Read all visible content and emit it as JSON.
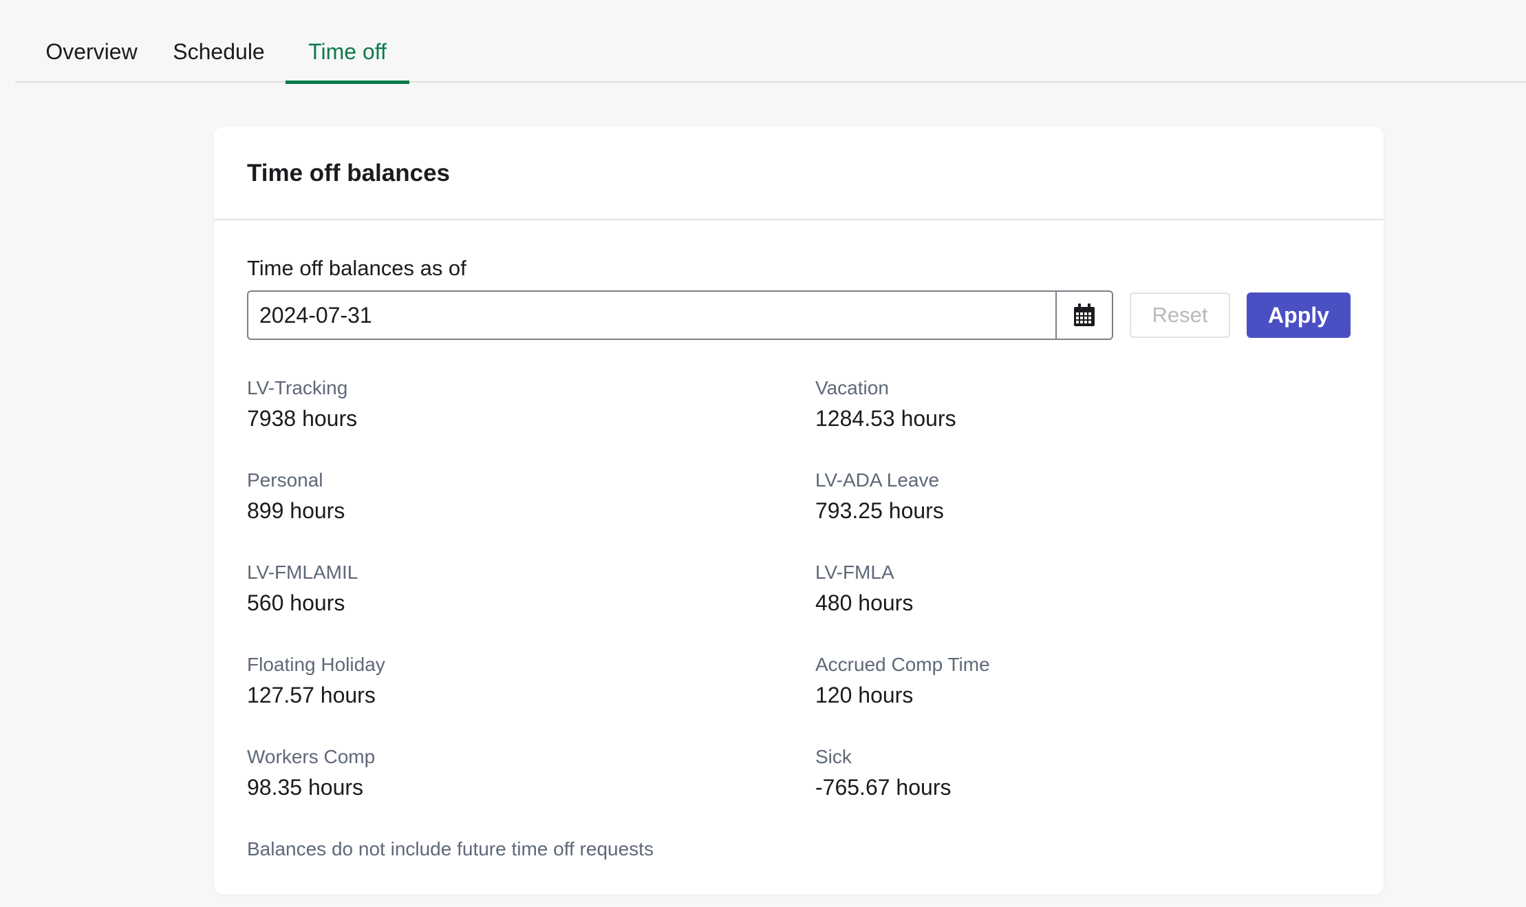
{
  "tabs": [
    {
      "label": "Overview",
      "active": false
    },
    {
      "label": "Schedule",
      "active": false
    },
    {
      "label": "Time off",
      "active": true
    }
  ],
  "card": {
    "title": "Time off balances",
    "as_of_label": "Time off balances as of",
    "date_value": "2024-07-31",
    "reset_label": "Reset",
    "apply_label": "Apply",
    "note": "Balances do not include future time off requests"
  },
  "balances": [
    {
      "name": "LV-Tracking",
      "value": "7938 hours"
    },
    {
      "name": "Vacation",
      "value": "1284.53 hours"
    },
    {
      "name": "Personal",
      "value": "899 hours"
    },
    {
      "name": "LV-ADA Leave",
      "value": "793.25 hours"
    },
    {
      "name": "LV-FMLAMIL",
      "value": "560 hours"
    },
    {
      "name": "LV-FMLA",
      "value": "480 hours"
    },
    {
      "name": "Floating Holiday",
      "value": "127.57 hours"
    },
    {
      "name": "Accrued Comp Time",
      "value": "120 hours"
    },
    {
      "name": "Workers Comp",
      "value": "98.35 hours"
    },
    {
      "name": "Sick",
      "value": "-765.67 hours"
    }
  ],
  "colors": {
    "active_tab": "#0a7a4a",
    "apply_button": "#4b4fc4",
    "muted_text": "#5e6878"
  },
  "icons": {
    "date_picker": "calendar-icon"
  }
}
